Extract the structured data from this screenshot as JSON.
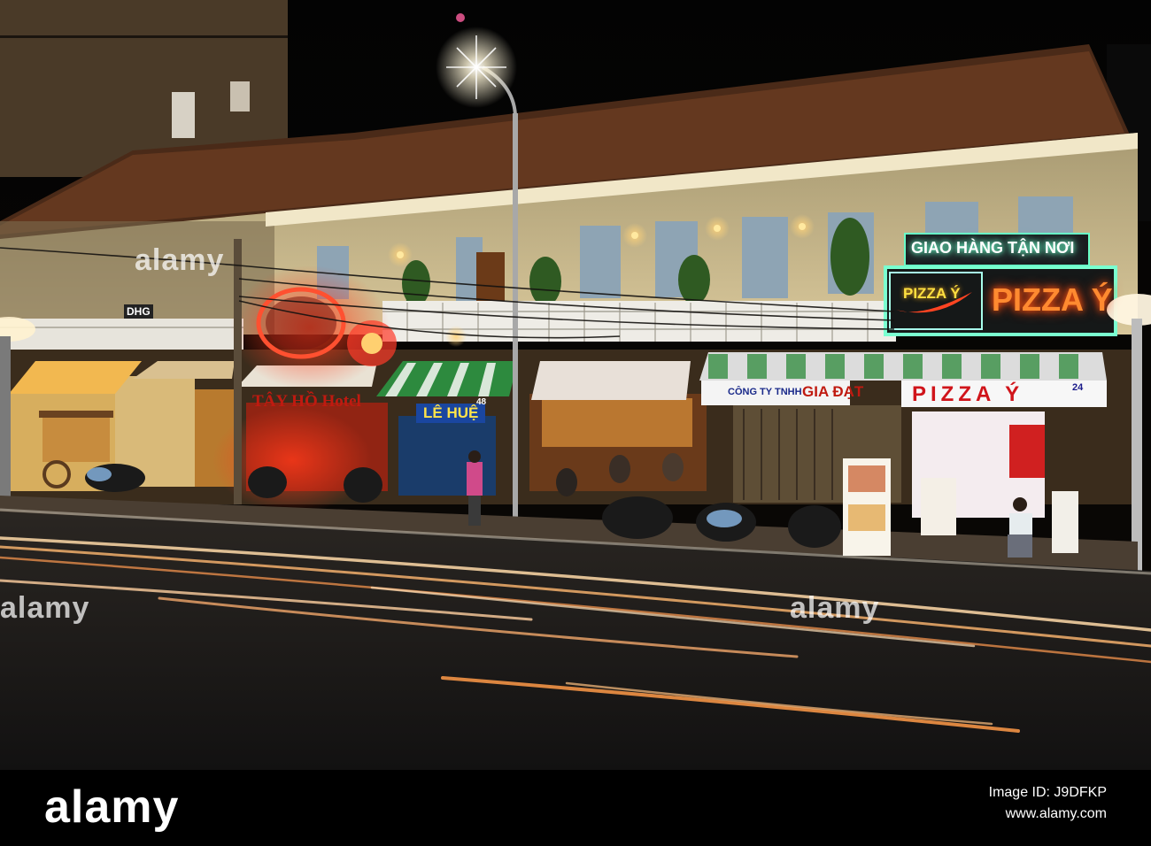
{
  "photo": {
    "signs": {
      "delivery": "GIAO HÀNG TẬN NƠI",
      "pizza_small": "PIZZA Ý",
      "pizza_big": "PIZZA Ý",
      "pizza_awning": "PIZZA Ý",
      "tay_ho": "TÂY HỒ Hotel",
      "le_hue": "LÊ HUỆ",
      "gia_dat": "GIA ĐẠT",
      "cong_ty": "CÔNG TY TNHH",
      "dhg": "DHG",
      "number_48": "48",
      "number_24": "24"
    },
    "watermarks": [
      "alamy",
      "alamy",
      "alamy"
    ]
  },
  "footer": {
    "logo": "alamy",
    "image_id": "Image ID: J9DFKP",
    "site": "www.alamy.com"
  }
}
